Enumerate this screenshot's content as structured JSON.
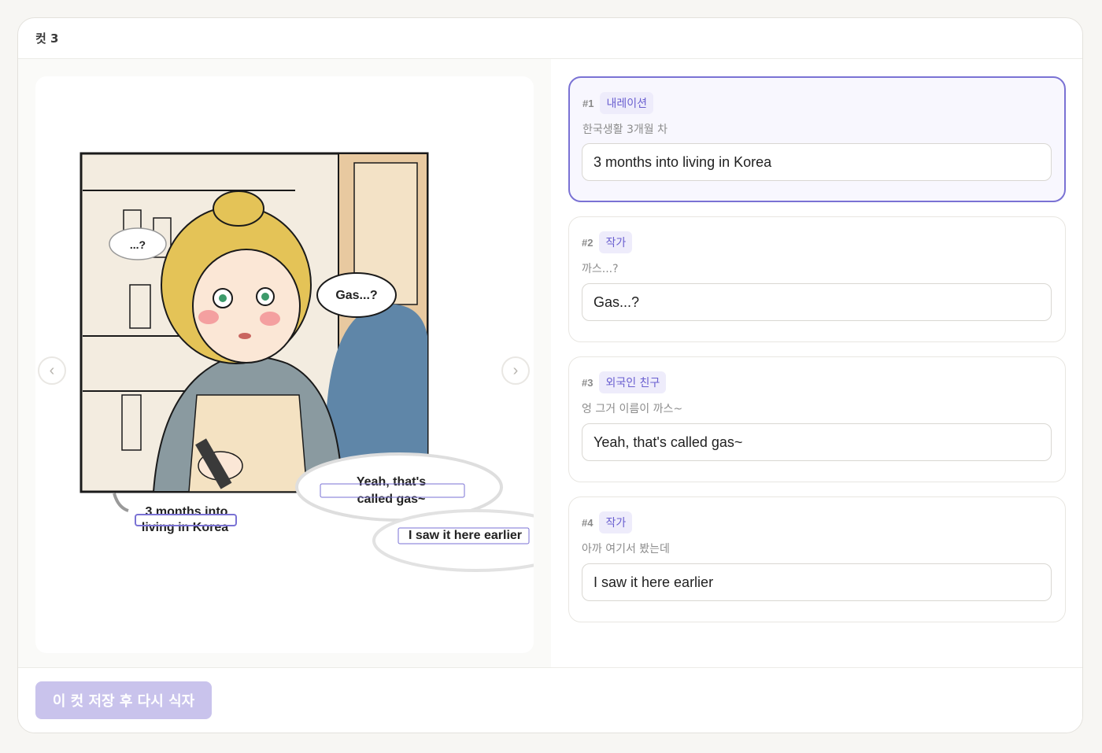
{
  "header": {
    "title": "컷 3"
  },
  "viewer": {
    "prev_label": "‹",
    "next_label": "›",
    "bubbles": {
      "question": "...?",
      "gas": "Gas...?",
      "called_line1": "Yeah, that's",
      "called_line2": "called gas~",
      "narration_line1": "3 months into",
      "narration_line2": "living in Korea",
      "earlier": "I saw it here earlier"
    }
  },
  "cuts": [
    {
      "num": "#1",
      "speaker": "내레이션",
      "original": "한국생활 3개월 차",
      "translation": "3 months into living in Korea"
    },
    {
      "num": "#2",
      "speaker": "작가",
      "original": "까스...?",
      "translation": "Gas...?"
    },
    {
      "num": "#3",
      "speaker": "외국인 친구",
      "original": "엉 그거 이름이 까스~",
      "translation": "Yeah, that's called gas~"
    },
    {
      "num": "#4",
      "speaker": "작가",
      "original": "아까 여기서 봤는데",
      "translation": "I saw it here earlier"
    }
  ],
  "footer": {
    "save_label": "이 컷 저장 후 다시 식자"
  },
  "colors": {
    "accent": "#7a72d4",
    "badge_bg": "#eeecfb",
    "button_disabled": "#c9c3ec"
  }
}
